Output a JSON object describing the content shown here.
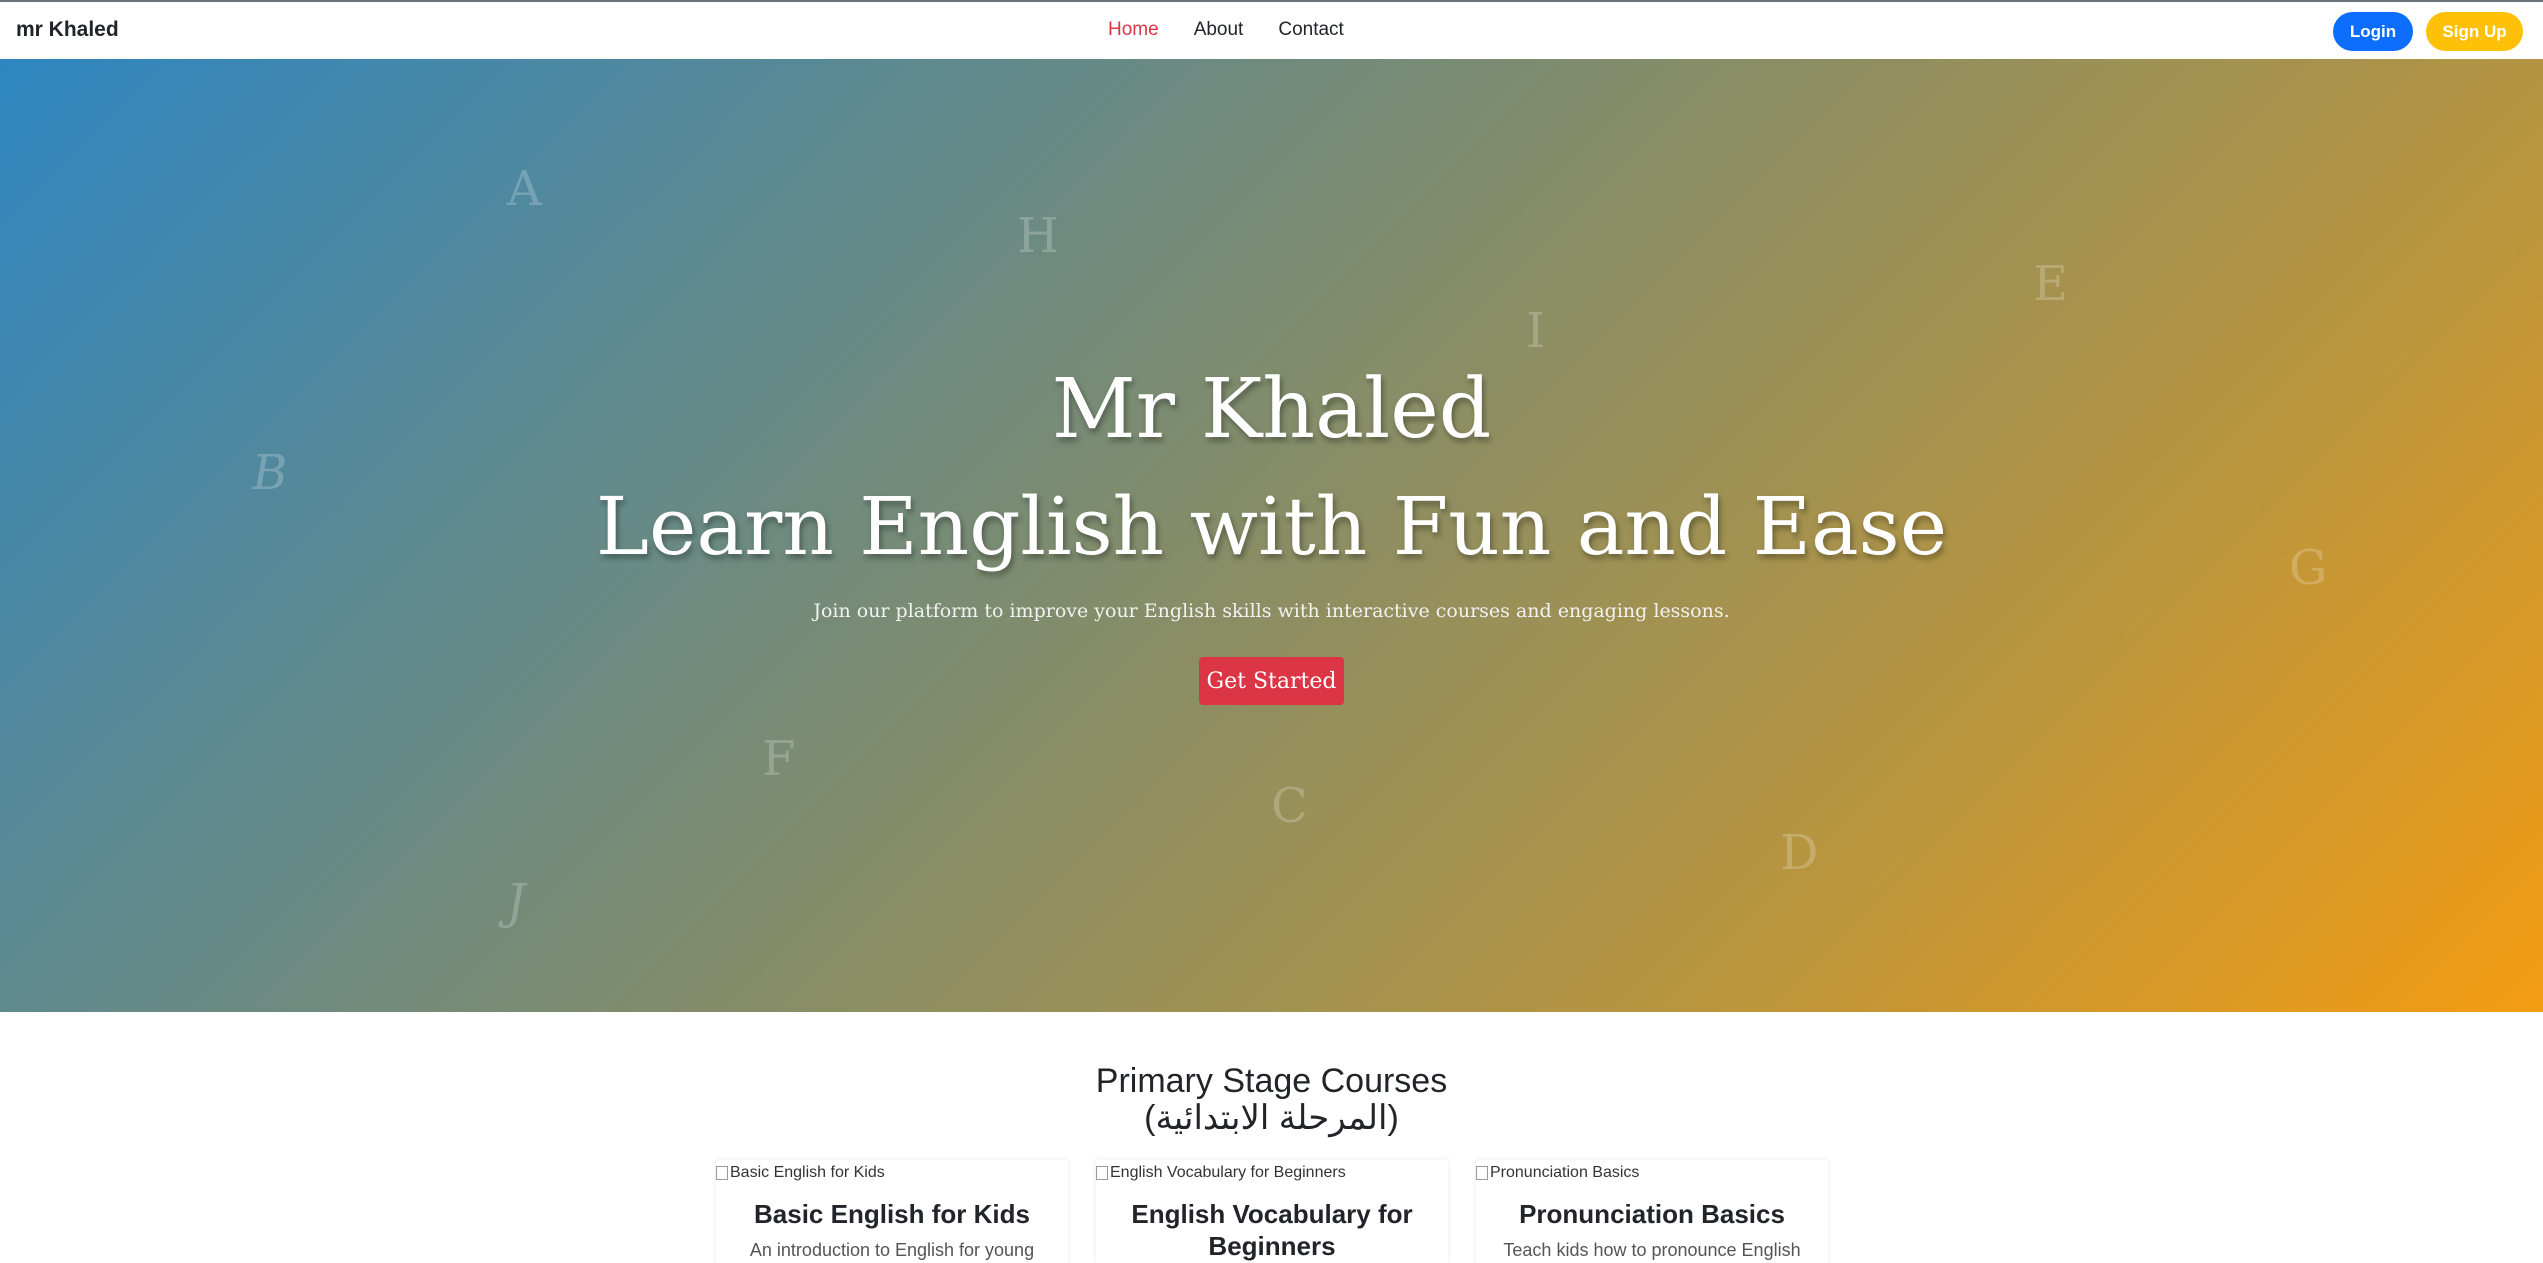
{
  "navbar": {
    "brand": "mr Khaled",
    "links": [
      {
        "label": "Home",
        "active": true
      },
      {
        "label": "About",
        "active": false
      },
      {
        "label": "Contact",
        "active": false
      }
    ],
    "login_label": "Login",
    "signup_label": "Sign Up"
  },
  "hero": {
    "title_line1": "Mr Khaled",
    "title_line2": "Learn English with Fun and Ease",
    "subtitle": "Join our platform to improve your English skills with interactive courses and engaging lessons.",
    "cta_label": "Get Started",
    "floating_letters": [
      "A",
      "H",
      "I",
      "E",
      "B",
      "G",
      "F",
      "C",
      "D",
      "J"
    ]
  },
  "courses": {
    "title_line1": "Primary Stage Courses",
    "title_line2": "(المرحلة الابتدائية)",
    "cards": [
      {
        "img_alt": "Basic English for Kids",
        "title": "Basic English for Kids",
        "description": "An introduction to English for young"
      },
      {
        "img_alt": "English Vocabulary for Beginners",
        "title": "English Vocabulary for Beginners",
        "description": ""
      },
      {
        "img_alt": "Pronunciation Basics",
        "title": "Pronunciation Basics",
        "description": "Teach kids how to pronounce English"
      }
    ]
  },
  "colors": {
    "accent_red": "#dc3545",
    "primary_blue": "#0d6efd",
    "warning_yellow": "#ffc107",
    "hero_gradient_start": "#2e86c1",
    "hero_gradient_end": "#f39c12"
  }
}
